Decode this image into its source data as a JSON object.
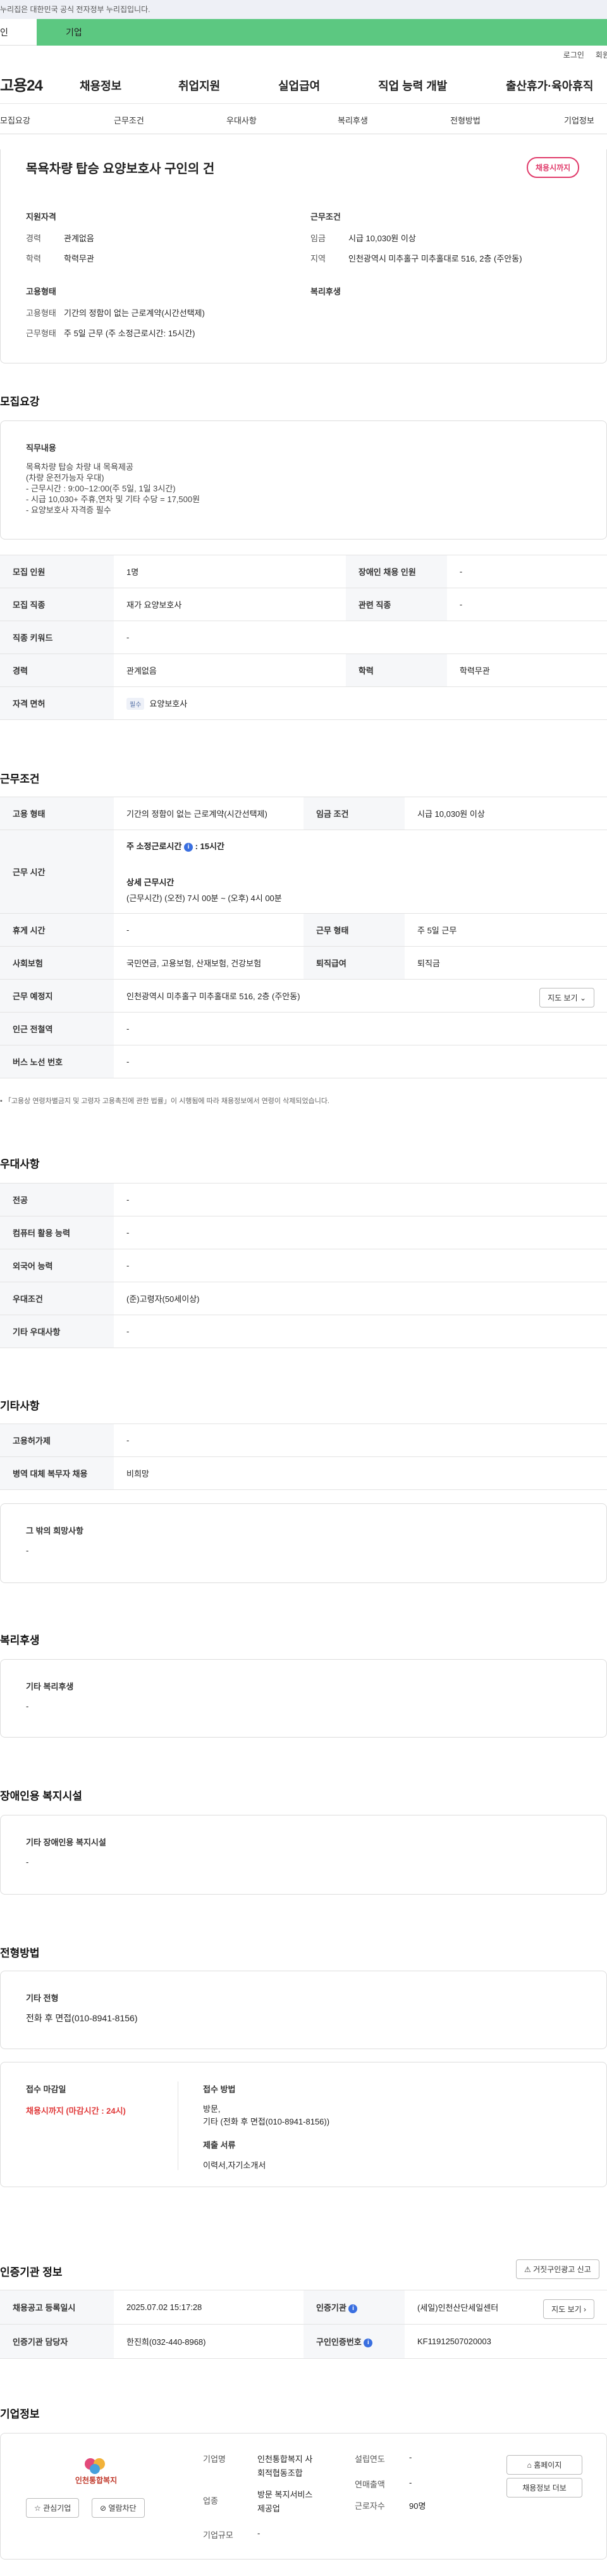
{
  "gov_notice": "누리집은 대한민국 공식 전자정부 누리집입니다.",
  "top_tabs": [
    "인",
    "기업"
  ],
  "util": {
    "login": "로그인",
    "join": "회원"
  },
  "logo": "고용24",
  "gnb": [
    "채용정보",
    "취업지원",
    "실업급여",
    "직업 능력 개발",
    "출산휴가·육아휴직"
  ],
  "subnav": [
    "모집요강",
    "근무조건",
    "우대사항",
    "복리후생",
    "전형방법",
    "기업정보"
  ],
  "summary": {
    "title": "목욕차량 탑승 요양보호사 구인의 건",
    "status_badge": "채용시까지",
    "qual_heading": "지원자격",
    "career_k": "경력",
    "career_v": "관계없음",
    "edu_k": "학력",
    "edu_v": "학력무관",
    "work_heading": "근무조건",
    "wage_k": "임금",
    "wage_v": "시급 10,030원 이상",
    "region_k": "지역",
    "region_v": "인천광역시 미추홀구 미추홀대로 516, 2층 (주안동)",
    "type_heading": "고용형태",
    "emp_k": "고용형태",
    "emp_v": "기간의 정함이 없는 근로계약(시간선택제)",
    "hours_k": "근무형태",
    "hours_v": "주 5일 근무 (주 소정근로시간: 15시간)",
    "welfare_heading": "복리후생"
  },
  "recruit": {
    "title": "모집요강",
    "duty_label": "직무내용",
    "duty_lines": [
      "목욕차량 탑승 차량 내 목욕제공",
      "(차량 운전가능자 우대)",
      "- 근무시간 : 9:00~12:00(주 5일, 1일 3시간)",
      "- 시급 10,030+ 주휴,연차 및 기타 수당 = 17,500원",
      "- 요양보호사 자격증 필수"
    ],
    "rows": {
      "headcount_k": "모집 인원",
      "headcount_v": "1명",
      "disabled_k": "장애인 채용 인원",
      "disabled_v": "-",
      "job_k": "모집 직종",
      "job_v": "재가 요양보호사",
      "related_k": "관련 직종",
      "related_v": "-",
      "keyword_k": "직종 키워드",
      "keyword_v": "-",
      "career_k": "경력",
      "career_v": "관계없음",
      "edu_k": "학력",
      "edu_v": "학력무관",
      "license_k": "자격 면허",
      "license_tag": "필수",
      "license_v": "요양보호사"
    }
  },
  "conditions": {
    "title": "근무조건",
    "emp_k": "고용 형태",
    "emp_v": "기간의 정함이 없는 근로계약(시간선택제)",
    "wage_k": "임금 조건",
    "wage_v": "시급 10,030원 이상",
    "time_k": "근무 시간",
    "weekly": "주 소정근로시간",
    "weekly_v": ": 15시간",
    "detail_label": "상세 근무시간",
    "detail_v": "(근무시간) (오전) 7시 00분 ~ (오후) 4시 00분",
    "rest_k": "휴게 시간",
    "rest_v": "-",
    "form_k": "근무 형태",
    "form_v": "주 5일 근무",
    "ins_k": "사회보험",
    "ins_v": "국민연금, 고용보험, 산재보험, 건강보험",
    "retire_k": "퇴직급여",
    "retire_v": "퇴직금",
    "place_k": "근무 예정지",
    "place_v": "인천광역시 미추홀구 미추홀대로 516, 2층 (주안동)",
    "map_btn": "지도 보기",
    "subway_k": "인근 전철역",
    "subway_v": "-",
    "bus_k": "버스 노선 번호",
    "bus_v": "-",
    "footnote": "「고용상 연령차별금지 및 고령자 고용촉진에 관한 법률」이 시행됨에 따라 채용정보에서 연령이 삭제되었습니다."
  },
  "prefs": {
    "title": "우대사항",
    "major_k": "전공",
    "major_v": "-",
    "pc_k": "컴퓨터 활용 능력",
    "pc_v": "-",
    "lang_k": "외국어 능력",
    "lang_v": "-",
    "cond_k": "우대조건",
    "cond_v": "(준)고령자(50세이상)",
    "etc_k": "기타 우대사항",
    "etc_v": "-"
  },
  "etc": {
    "title": "기타사항",
    "form_k": "고용허가제",
    "form_v": "-",
    "army_k": "병역 대체 복무자 채용",
    "army_v": "비희망",
    "other_label": "그 밖의 희망사항",
    "other_v": "-"
  },
  "welfare": {
    "title": "복리후생",
    "label": "기타 복리후생",
    "value": "-"
  },
  "facility": {
    "title": "장애인용 복지시설",
    "label": "기타 장애인용 복지시설",
    "value": "-"
  },
  "selection": {
    "title": "전형방법",
    "label": "기타 전형",
    "value": "전화 후 면접(010-8941-8156)",
    "deadline_label": "접수 마감일",
    "deadline_v": "채용시까지 (마감시간 : 24시)",
    "method_label": "접수 방법",
    "method_1": "방문,",
    "method_2": "기타 (전화 후 면접(010-8941-8156))",
    "docs_label": "제출 서류",
    "docs_v": "이력서,자기소개서"
  },
  "agency": {
    "title": "인증기관 정보",
    "report_btn": "거짓구인광고 신고",
    "reg_k": "채용공고 등록일시",
    "reg_v": "2025.07.02 15:17:28",
    "org_k": "인증기관",
    "org_v": "(세일)인천산단세일센터",
    "map_btn": "지도 보기",
    "staff_k": "인증기관 담당자",
    "staff_v": "한진희(032-440-8968)",
    "no_k": "구인인증번호",
    "no_v": "KF11912507020003"
  },
  "company": {
    "title": "기업정보",
    "logo_text": "인천통합복지",
    "fav_btn": "관심기업",
    "block_btn": "열람차단",
    "name_k": "기업명",
    "name_v1": "인천통합복지 사",
    "name_v2": "회적협동조합",
    "found_k": "설립연도",
    "found_v": "-",
    "biz_k": "업종",
    "biz_v1": "방문 복지서비스",
    "biz_v2": "제공업",
    "sales_k": "연매출액",
    "sales_v": "-",
    "emp_k": "근로자수",
    "emp_v": "90명",
    "size_k": "기업규모",
    "size_v": "-",
    "home_btn": "홈페이지",
    "jobs_btn": "채용정보 더보"
  }
}
